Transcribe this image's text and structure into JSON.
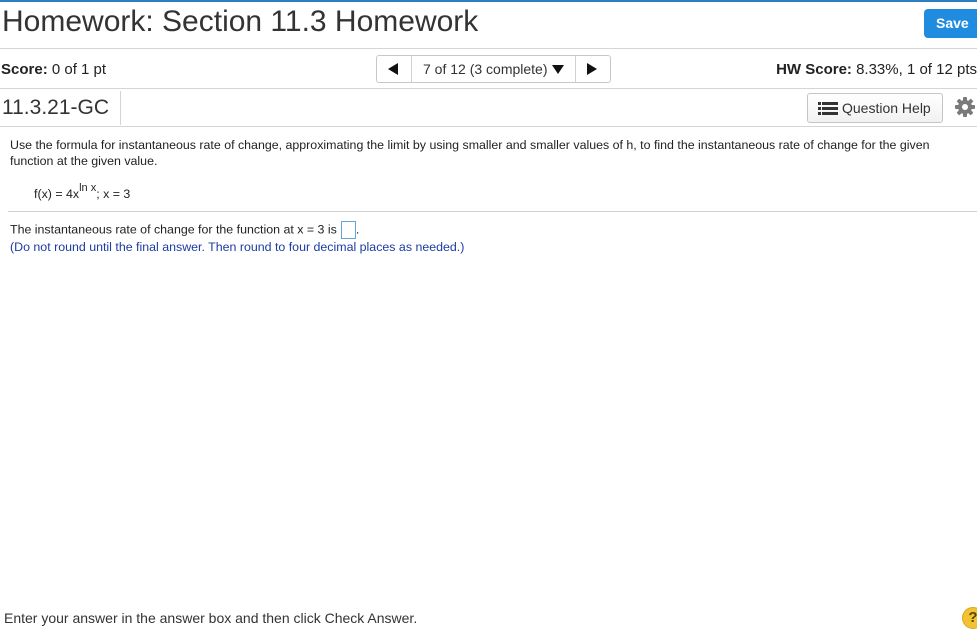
{
  "header": {
    "title": "Homework: Section 11.3 Homework",
    "save_label": "Save"
  },
  "score_bar": {
    "score_label": "Score:",
    "score_value": "0 of 1 pt",
    "nav_text": "7 of 12 (3 complete)",
    "hw_score_label": "HW Score:",
    "hw_score_value": "8.33%, 1 of 12 pts"
  },
  "question_bar": {
    "question_id": "11.3.21-GC",
    "help_label": "Question Help"
  },
  "question": {
    "instructions": "Use the formula for instantaneous rate of change, approximating the limit by using smaller and smaller values of h, to find the instantaneous rate of change for the given function at the given value.",
    "formula_base": "f(x) = 4x",
    "formula_exponent": "ln x",
    "formula_tail": "; x = 3",
    "answer_prompt": "The instantaneous rate of change for the function at x = 3 is",
    "answer_suffix": ".",
    "round_note": "(Do not round until the final answer. Then round to four decimal places as needed.)"
  },
  "footer": {
    "text": "Enter your answer in the answer box and then click Check Answer.",
    "help_glyph": "?"
  },
  "colors": {
    "accent": "#1f8ce0",
    "note_text": "#1b3ca3",
    "help_circle": "#f1c232"
  },
  "icons": [
    "previous-arrow-icon",
    "dropdown-caret-icon",
    "next-arrow-icon",
    "list-icon",
    "gear-icon",
    "help-circle-icon"
  ]
}
